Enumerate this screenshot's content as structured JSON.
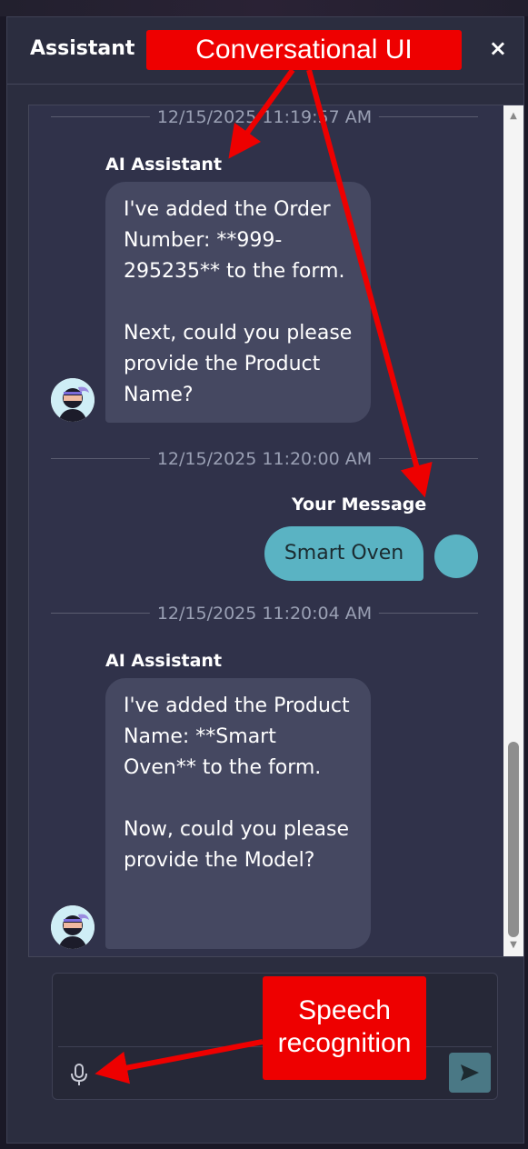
{
  "header": {
    "title": "Assistant",
    "close_icon": "×"
  },
  "messages": [
    {
      "timestamp": "12/15/2025 11:19:57 AM",
      "sender": "AI Assistant",
      "paragraphs": [
        "I've added the Order Number: **999-295235** to the form.",
        "Next, could you please provide the Product Name?"
      ]
    },
    {
      "timestamp": "12/15/2025 11:20:00 AM",
      "sender": "Your Message",
      "text": "Smart Oven"
    },
    {
      "timestamp": "12/15/2025 11:20:04 AM",
      "sender": "AI Assistant",
      "paragraphs": [
        "I've added the Product Name: **Smart Oven** to the form.",
        "Now, could you please provide the Model?"
      ]
    }
  ],
  "input": {
    "value": "",
    "mic_icon": "microphone-icon",
    "send_icon": "send-icon"
  },
  "annotations": {
    "conversational": "Conversational UI",
    "speech_line1": "Speech",
    "speech_line2": "recognition"
  },
  "colors": {
    "panel": "#2b2d3f",
    "ai_bubble": "#454861",
    "user_bubble": "#5ab3c3",
    "callout": "#ee0000",
    "send_button": "#4a7885"
  }
}
